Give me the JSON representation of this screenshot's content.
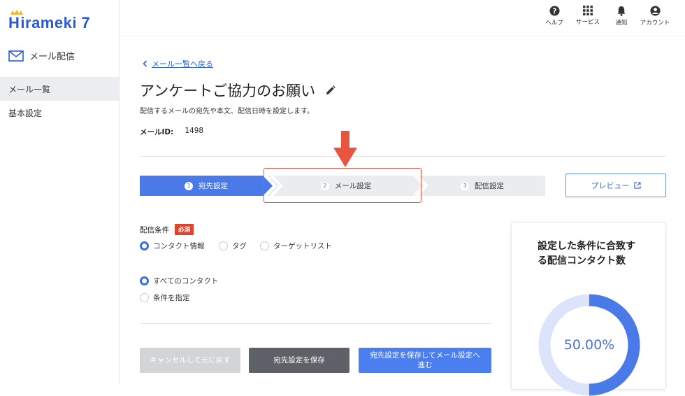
{
  "brand": {
    "logo_text": "irameki 7",
    "logo_initial": "H"
  },
  "sidebar": {
    "app_title": "メール配信",
    "items": [
      {
        "label": "メール一覧",
        "active": true
      },
      {
        "label": "基本設定",
        "active": false
      }
    ]
  },
  "topbar": {
    "icons": [
      {
        "icon": "help-icon",
        "label": "ヘルプ"
      },
      {
        "icon": "services-grid-icon",
        "label": "サービス"
      },
      {
        "icon": "bell-icon",
        "label": "通知"
      },
      {
        "icon": "account-icon",
        "label": "アカウント"
      }
    ]
  },
  "main": {
    "back_link": "メール一覧へ戻る",
    "title": "アンケートご協力のお願い",
    "description": "配信するメールの宛先や本文、配信日時を設定します。",
    "mail_id_label": "メールID:",
    "mail_id_value": "1498"
  },
  "steps": [
    {
      "num": "1",
      "label": "宛先設定",
      "state": "active"
    },
    {
      "num": "2",
      "label": "メール設定",
      "state": "inactive"
    },
    {
      "num": "3",
      "label": "配信設定",
      "state": "inactive"
    }
  ],
  "preview_button": "プレビュー",
  "conditions": {
    "label": "配信条件",
    "required_badge": "必須",
    "type_options": [
      {
        "label": "コンタクト情報",
        "selected": true
      },
      {
        "label": "タグ",
        "selected": false
      },
      {
        "label": "ターゲットリスト",
        "selected": false
      }
    ],
    "scope_options": [
      {
        "label": "すべてのコンタクト",
        "selected": true
      },
      {
        "label": "条件を指定",
        "selected": false
      }
    ]
  },
  "buttons": {
    "cancel": "キャンセルして元に戻す",
    "save": "宛先設定を保存",
    "save_next": "宛先設定を保存してメール設定へ進む"
  },
  "summary_card": {
    "title": "設定した条件に合致する配信コンタクト数",
    "percent_text": "50.00%",
    "percent_value": 0.5
  },
  "colors": {
    "brand_blue": "#2a5bd7",
    "step_active": "#4a7ae8",
    "step_inactive": "#ebecee",
    "highlight": "#e8543e",
    "required": "#e0442c",
    "donut_fill": "#4a7ae8",
    "donut_track": "#dbe4fa"
  }
}
